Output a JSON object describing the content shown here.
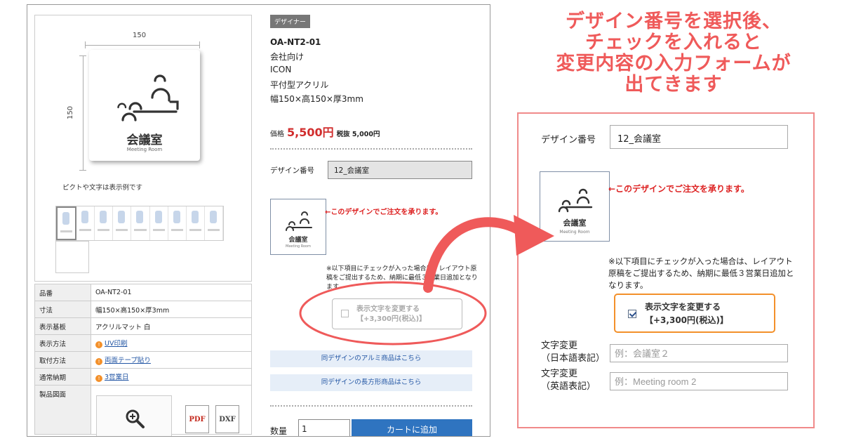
{
  "product": {
    "designer_tag": "デザイナー",
    "code": "OA-NT2-01",
    "lines": [
      "会社向け",
      "ICON",
      "平付型アクリル",
      "幅150×高150×厚3mm"
    ],
    "price_label": "価格",
    "price_value": "5,500円",
    "price_excl": "税抜 5,000円"
  },
  "image": {
    "dim_width": "150",
    "dim_height": "150",
    "plate_name": "会議室",
    "plate_sub": "Meeting Room",
    "sample_note": "ピクトや文字は表示例です"
  },
  "spec": [
    {
      "key": "品番",
      "value": "OA-NT2-01",
      "link": false
    },
    {
      "key": "寸法",
      "value": "幅150×高150×厚3mm",
      "link": false
    },
    {
      "key": "表示基板",
      "value": "アクリルマット 白",
      "link": false
    },
    {
      "key": "表示方法",
      "value": "UV印刷",
      "link": true
    },
    {
      "key": "取付方法",
      "value": "両面テープ貼り",
      "link": true
    },
    {
      "key": "通常納期",
      "value": "3営業日",
      "link": true
    },
    {
      "key": "製品図面",
      "value": "",
      "link": false
    }
  ],
  "files": {
    "pdf": "PDF",
    "dxf": "DXF"
  },
  "design_no": {
    "label": "デザイン番号",
    "value": "12_会議室"
  },
  "accept_text": "←このデザインでご注文を承ります。",
  "notice": "※以下項目にチェックが入った場合は、レイアウト原稿をご提出するため、納期に最低３営業日追加となります。",
  "change_option": {
    "line1": "表示文字を変更する",
    "line2": "【+3,300円(税込)】"
  },
  "links": [
    "同デザインのアルミ商品はこちら",
    "同デザインの長方形商品はこちら"
  ],
  "cart": {
    "qty_label": "数量",
    "qty_value": "1",
    "button": "カートに追加"
  },
  "headline": [
    "デザイン番号を選択後、",
    "チェックを入れると",
    "変更内容の入力フォームが",
    "出てきます"
  ],
  "form": {
    "jp_label_1": "文字変更",
    "jp_label_2": "（日本語表記）",
    "jp_placeholder": "例：会議室２",
    "en_label_1": "文字変更",
    "en_label_2": "（英語表記）",
    "en_placeholder": "例：Meeting room 2"
  },
  "colors": {
    "accent_red": "#ef5a5a",
    "price_red": "#d12d2d",
    "cart_blue": "#2f74c0",
    "check_orange": "#f3902a"
  }
}
